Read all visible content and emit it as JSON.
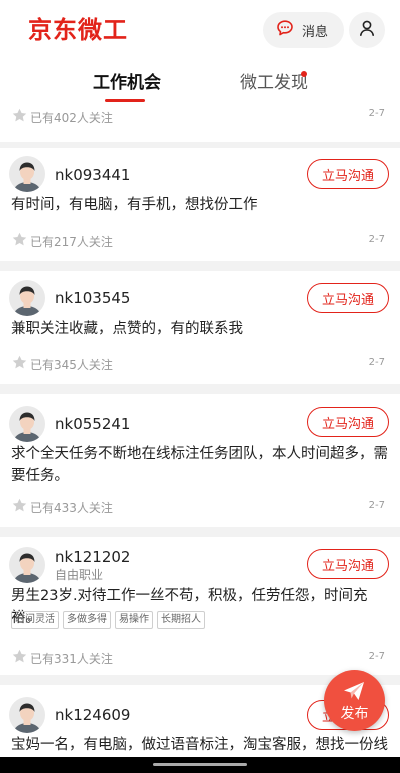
{
  "header": {
    "logo": "京东微工",
    "message_label": "消息"
  },
  "tabs": [
    {
      "label": "工作机会"
    },
    {
      "label": "微工发现"
    }
  ],
  "first_item": {
    "follow": "已有402人关注",
    "date": "2-7"
  },
  "contact_label": "立马沟通",
  "posts": [
    {
      "username": "nk093441",
      "subtitle": "",
      "description": "有时间，有电脑，有手机，想找份工作",
      "tags": [],
      "follow": "已有217人关注",
      "date": "2-7"
    },
    {
      "username": "nk103545",
      "subtitle": "",
      "description": "兼职关注收藏，点赞的，有的联系我",
      "tags": [],
      "follow": "已有345人关注",
      "date": "2-7"
    },
    {
      "username": "nk055241",
      "subtitle": "",
      "description": "求个全天任务不断地在线标注任务团队，本人时间超多，需要任务。",
      "tags": [],
      "follow": "已有433人关注",
      "date": "2-7"
    },
    {
      "username": "nk121202",
      "subtitle": "自由职业",
      "description": "男生23岁.对待工作一丝不苟，积极，任劳任怨，时间充裕。",
      "tags": [
        "时间灵活",
        "多做多得",
        "易操作",
        "长期招人"
      ],
      "follow": "已有331人关注",
      "date": "2-7"
    },
    {
      "username": "nk124609",
      "subtitle": "",
      "description": "宝妈一名，有电脑，做过语音标注，淘宝客服，想找一份线",
      "tags": [],
      "follow": "",
      "date": ""
    }
  ],
  "fab": {
    "label": "发布"
  },
  "icons": {
    "message": "chat-bubble-icon",
    "user": "user-icon",
    "follow": "star-icon",
    "avatar": "avatar-icon",
    "fab": "paper-plane-icon"
  },
  "colors": {
    "accent": "#e2231a",
    "fab": "#f0503f",
    "background": "#f2f2f2"
  }
}
